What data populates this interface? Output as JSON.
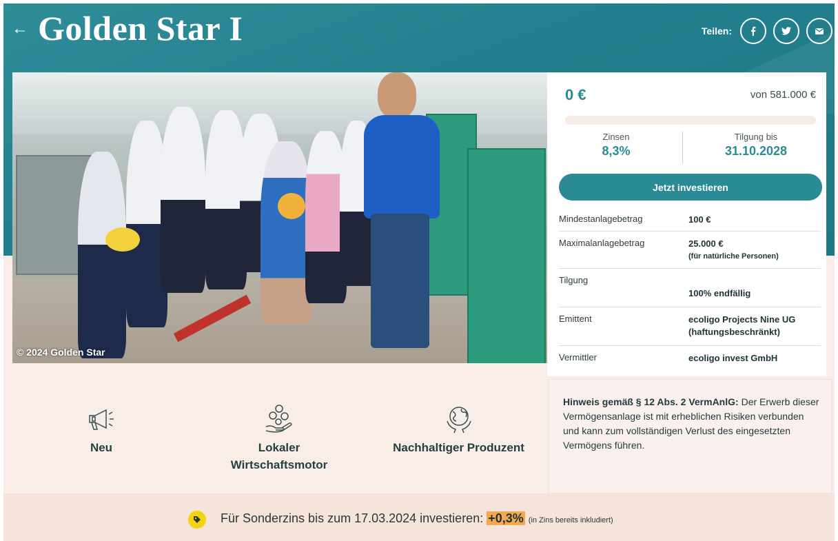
{
  "header": {
    "title": "Golden Star I",
    "back_label": "←",
    "share_label": "Teilen:",
    "share_buttons": [
      "facebook-icon",
      "twitter-icon",
      "email-icon"
    ]
  },
  "photo": {
    "caption": "© 2024 Golden Star"
  },
  "invest": {
    "amount": "0 €",
    "goal": "von 581.000 €",
    "progress": 0,
    "interest_label": "Zinsen",
    "interest_value": "8,3%",
    "repayment_label": "Tilgung bis",
    "repayment_value": "31.10.2028",
    "button_label": "Jetzt investieren",
    "details": [
      {
        "key": "Mindestanlagebetrag",
        "value": "100 €",
        "note": ""
      },
      {
        "key": "Maximalanlagebetrag",
        "value": "25.000 €",
        "note": "(für natürliche Personen)"
      },
      {
        "key": "Tilgung",
        "value": "100% endfällig",
        "note": ""
      },
      {
        "key": "Emittent",
        "value": "ecoligo Projects Nine UG (haftungsbeschränkt)",
        "note": ""
      },
      {
        "key": "Vermittler",
        "value": "ecoligo invest GmbH",
        "note": ""
      }
    ]
  },
  "features": [
    {
      "label": "Neu",
      "icon": "megaphone-icon"
    },
    {
      "label": "Lokaler Wirtschaftsmotor",
      "icon": "coins-hand-icon"
    },
    {
      "label": "Nachhaltiger Produzent",
      "icon": "globe-hands-icon"
    }
  ],
  "hint": {
    "title": "Hinweis gemäß § 12 Abs. 2 VermAnlG:",
    "text": "Der Erwerb dieser Vermögensanlage ist mit erheblichen Risiken verbunden und kann zum vollständigen Verlust des eingesetzten Vermögens führen."
  },
  "bonus": {
    "text": "Für Sonderzins bis zum 17.03.2024 investieren:",
    "rate": "+0,3%",
    "note": "(in Zins bereits inkludiert)"
  },
  "colors": {
    "brand": "#2a8a96",
    "header": "#237f8d",
    "background": "#f9ede8",
    "bonus_icon": "#f5d40f",
    "bonus_highlight": "#f5a94f"
  }
}
